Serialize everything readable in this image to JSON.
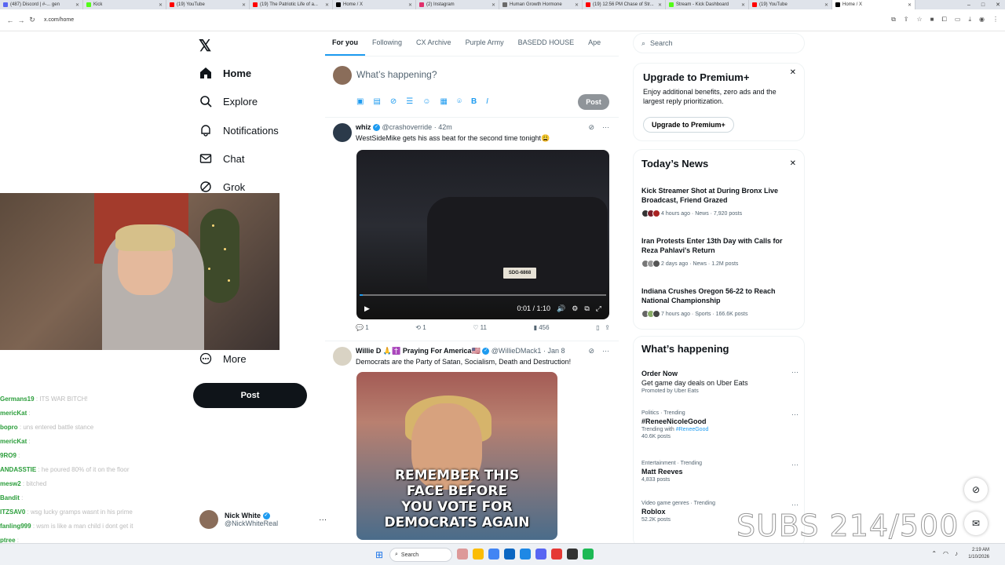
{
  "browser": {
    "tabs": [
      {
        "label": "(487) Discord | #-... gen",
        "color": "#5865f2"
      },
      {
        "label": "Kick",
        "color": "#53fc18"
      },
      {
        "label": "(19) YouTube",
        "color": "#ff0000"
      },
      {
        "label": "(19) The Patriotic Life of a...",
        "color": "#ff0000"
      },
      {
        "label": "Home / X",
        "color": "#000000"
      },
      {
        "label": "(2) Instagram",
        "color": "#e1306c"
      },
      {
        "label": "Human Growth Hormone",
        "color": "#6a6a6a"
      },
      {
        "label": "(19) 12:56 PM Chase of Str...",
        "color": "#ff0000"
      },
      {
        "label": "Stream - Kick Dashboard",
        "color": "#53fc18"
      },
      {
        "label": "(19) YouTube",
        "color": "#ff0000"
      },
      {
        "label": "Home / X",
        "color": "#000000"
      }
    ],
    "url": "x.com/home"
  },
  "nav": {
    "items": [
      {
        "label": "Home",
        "icon": "home-icon"
      },
      {
        "label": "Explore",
        "icon": "search-icon"
      },
      {
        "label": "Notifications",
        "icon": "bell-icon"
      },
      {
        "label": "Chat",
        "icon": "mail-icon"
      },
      {
        "label": "Grok",
        "icon": "grok-icon"
      },
      {
        "label": "More",
        "icon": "more-icon"
      }
    ],
    "post_label": "Post",
    "profile": {
      "name": "Nick White",
      "handle": "@NickWhiteReal"
    }
  },
  "chat": [
    {
      "user": "Germans19",
      "msg": ": ITS WAR BITCH!"
    },
    {
      "user": "mericKat",
      "msg": ":"
    },
    {
      "user": "bopro",
      "msg": ": uns entered battle stance"
    },
    {
      "user": "mericKat",
      "msg": ":"
    },
    {
      "user": "9RO9",
      "msg": ":"
    },
    {
      "user": "ANDASSTIE",
      "msg": ": he poured 80% of it on the floor"
    },
    {
      "user": "mesw2",
      "msg": ": bitched"
    },
    {
      "user": "Bandit",
      "msg": ":"
    },
    {
      "user": "ITZSAV0",
      "msg": ": wsg lucky gramps wasnt in his prime"
    },
    {
      "user": "fanling999",
      "msg": ": wsm is like a man child i dont get it"
    },
    {
      "user": "ptree",
      "msg": ":"
    },
    {
      "user": "mericKat",
      "msg": ":"
    }
  ],
  "timeline": {
    "tabs": [
      "For you",
      "Following",
      "CX Archive",
      "Purple Army",
      "BASEDD HOUSE",
      "Ape"
    ],
    "compose_placeholder": "What’s happening?",
    "compose_post": "Post",
    "tweets": [
      {
        "name": "whiz",
        "handle": "@crashoverride",
        "time": "· 42m",
        "text": "WestSideMike gets his ass beat for the second time tonight😩",
        "video_time": "0:01 / 1:10",
        "video_progress": 0.014,
        "plate": "SDG-6868",
        "replies": "1",
        "reposts": "1",
        "likes": "11",
        "views": "456"
      },
      {
        "name": "Willie D 🙏✝️ Praying For America🇺🇸",
        "handle": "@WillieDMack1",
        "time": "· Jan 8",
        "text": "Democrats are the Party of Satan, Socialism, Death and Destruction!",
        "meme": "REMEMBER THIS\nFACE BEFORE\nYOU VOTE FOR\nDEMOCRATS AGAIN"
      }
    ]
  },
  "sidebar": {
    "search_placeholder": "Search",
    "premium": {
      "title": "Upgrade to Premium+",
      "desc": "Enjoy additional benefits, zero ads and the largest reply prioritization.",
      "button": "Upgrade to Premium+"
    },
    "news": {
      "title": "Today’s News",
      "items": [
        {
          "title": "Kick Streamer Shot at During Bronx Live Broadcast, Friend Grazed",
          "meta": "4 hours ago · News · 7,920 posts"
        },
        {
          "title": "Iran Protests Enter 13th Day with Calls for Reza Pahlavi's Return",
          "meta": "2 days ago · News · 1.2M posts"
        },
        {
          "title": "Indiana Crushes Oregon 56-22 to Reach National Championship",
          "meta": "7 hours ago · Sports · 166.6K posts"
        }
      ]
    },
    "happening": {
      "title": "What’s happening",
      "ad": {
        "title": "Order Now",
        "desc": "Get game day deals on Uber Eats",
        "promo": "Promoted by Uber Eats"
      },
      "trends": [
        {
          "ctx": "Politics · Trending",
          "name": "#ReneeNicoleGood",
          "with_label": "Trending with",
          "with_tag": "#ReneeGood",
          "count": "40.6K posts"
        },
        {
          "ctx": "Entertainment · Trending",
          "name": "Matt Reeves",
          "count": "4,833 posts"
        },
        {
          "ctx": "Video game genres · Trending",
          "name": "Roblox",
          "count": "52.2K posts"
        }
      ]
    }
  },
  "overlay": {
    "subs": "SUBS 214/500"
  },
  "taskbar": {
    "search": "Search",
    "time": "2:19 AM",
    "date": "1/10/2026"
  }
}
